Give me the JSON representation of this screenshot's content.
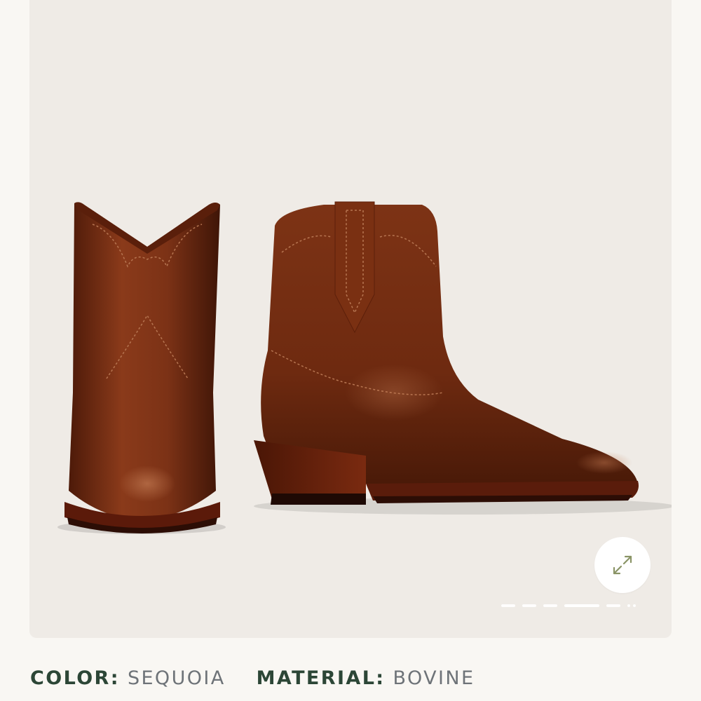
{
  "gallery": {
    "image_alt": "Brown leather western ankle boots, front and side view",
    "expand_icon": "expand-arrows-icon",
    "slide_count": 7,
    "active_slide": 4
  },
  "attributes": {
    "color": {
      "label": "COLOR:",
      "value": "SEQUOIA"
    },
    "material": {
      "label": "MATERIAL:",
      "value": "BOVINE"
    }
  },
  "colors": {
    "background": "#f9f7f3",
    "gallery_bg": "#efebe6",
    "label": "#2c4636",
    "value": "#6e7378",
    "leather": "#7a2f16",
    "icon": "#8a9466"
  }
}
